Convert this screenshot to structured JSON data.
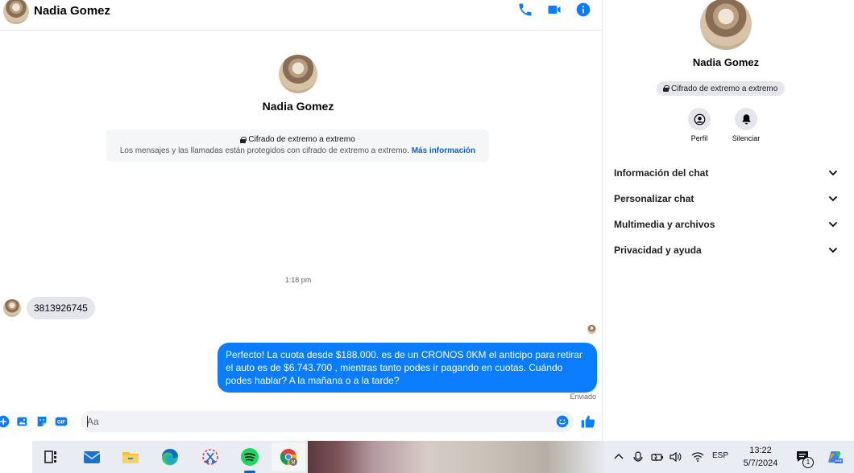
{
  "header": {
    "name": "Nadia Gomez"
  },
  "intro": {
    "name": "Nadia Gomez"
  },
  "encryption": {
    "title": "Cifrado de extremo a extremo",
    "description": "Los mensajes y las llamadas están protegidos con cifrado de extremo a extremo.",
    "link": "Más información"
  },
  "messages": {
    "timestamp": "1:18 pm",
    "incoming": "3813926745",
    "outgoing": "Perfecto! La cuota desde $188.000. es de un CRONOS 0KM el anticipo para retirar el auto es de $6.743.700 , mientras tanto podes ir pagando en cuotas. Cuándo podes hablar? A la mañana o a la tarde?",
    "status": "Enviado"
  },
  "composer": {
    "placeholder": "Aa"
  },
  "side": {
    "name": "Nadia Gomez",
    "badge": "Cifrado de extremo a extremo",
    "actions": [
      {
        "label": "Perfil"
      },
      {
        "label": "Silenciar"
      }
    ],
    "menu": [
      {
        "label": "Información del chat"
      },
      {
        "label": "Personalizar chat"
      },
      {
        "label": "Multimedia y archivos"
      },
      {
        "label": "Privacidad y ayuda"
      }
    ]
  },
  "taskbar": {
    "lang": "ESP",
    "time": "13:22",
    "date": "5/7/2024",
    "notifications": "1"
  },
  "colors": {
    "accent": "#0a7cff",
    "link": "#0a62d8"
  }
}
